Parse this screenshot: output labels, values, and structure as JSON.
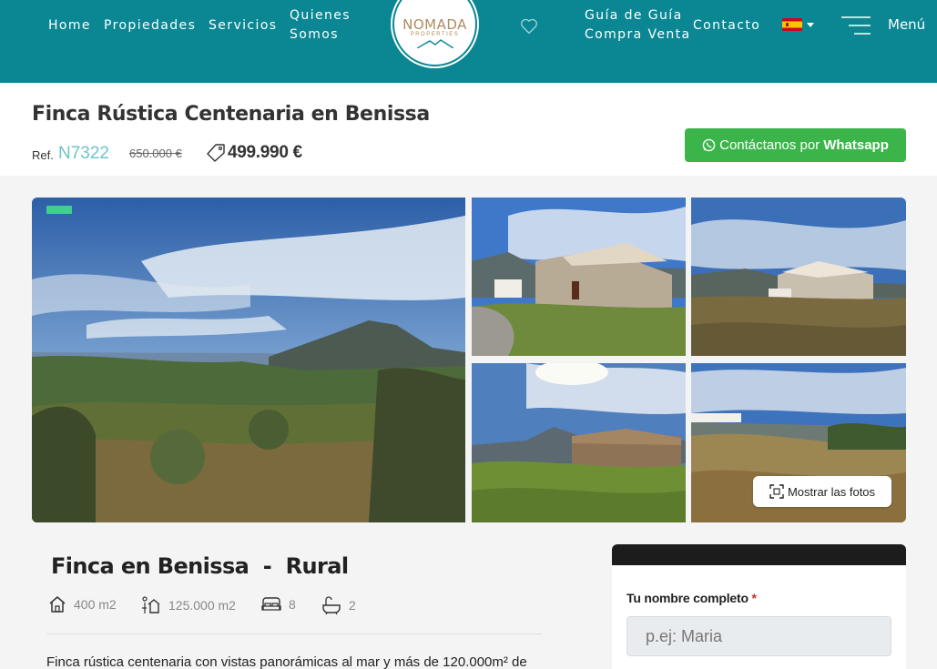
{
  "nav": {
    "home": "Home",
    "properties": "Propiedades",
    "services": "Servicios",
    "about_line1": "Quienes",
    "about_line2": "Somos",
    "guide_line1": "Guía de Guía",
    "guide_line2": "Compra Venta",
    "contact": "Contacto",
    "menu": "Menú",
    "language_flag": "spain-flag"
  },
  "logo": {
    "title": "NOMADA",
    "subtitle": "PROPERTIES"
  },
  "property": {
    "title": "Finca Rústica Centenaria en Benissa",
    "ref_label": "Ref.",
    "ref_value": "N7322",
    "old_price": "650.000 €",
    "price": "499.990 €",
    "whatsapp_prefix": "Contáctanos por",
    "whatsapp_bold": "Whatsapp"
  },
  "gallery": {
    "show_photos": "Mostrar las fotos"
  },
  "details": {
    "heading": "Finca en Benissa  -  Rural",
    "built_area": "400 m2",
    "plot_area": "125.000 m2",
    "bedrooms": "8",
    "bathrooms": "2",
    "description": "Finca rústica centenaria con vistas panorámicas al mar y más de 120.000m² de"
  },
  "form": {
    "name_label": "Tu nombre completo",
    "required_mark": "*",
    "name_placeholder": "p.ej: Maria"
  },
  "colors": {
    "header_teal": "#0a8793",
    "whatsapp_green": "#3bb54a",
    "ref_accent": "#6cc4c9",
    "badge_green": "#3fd08f"
  }
}
